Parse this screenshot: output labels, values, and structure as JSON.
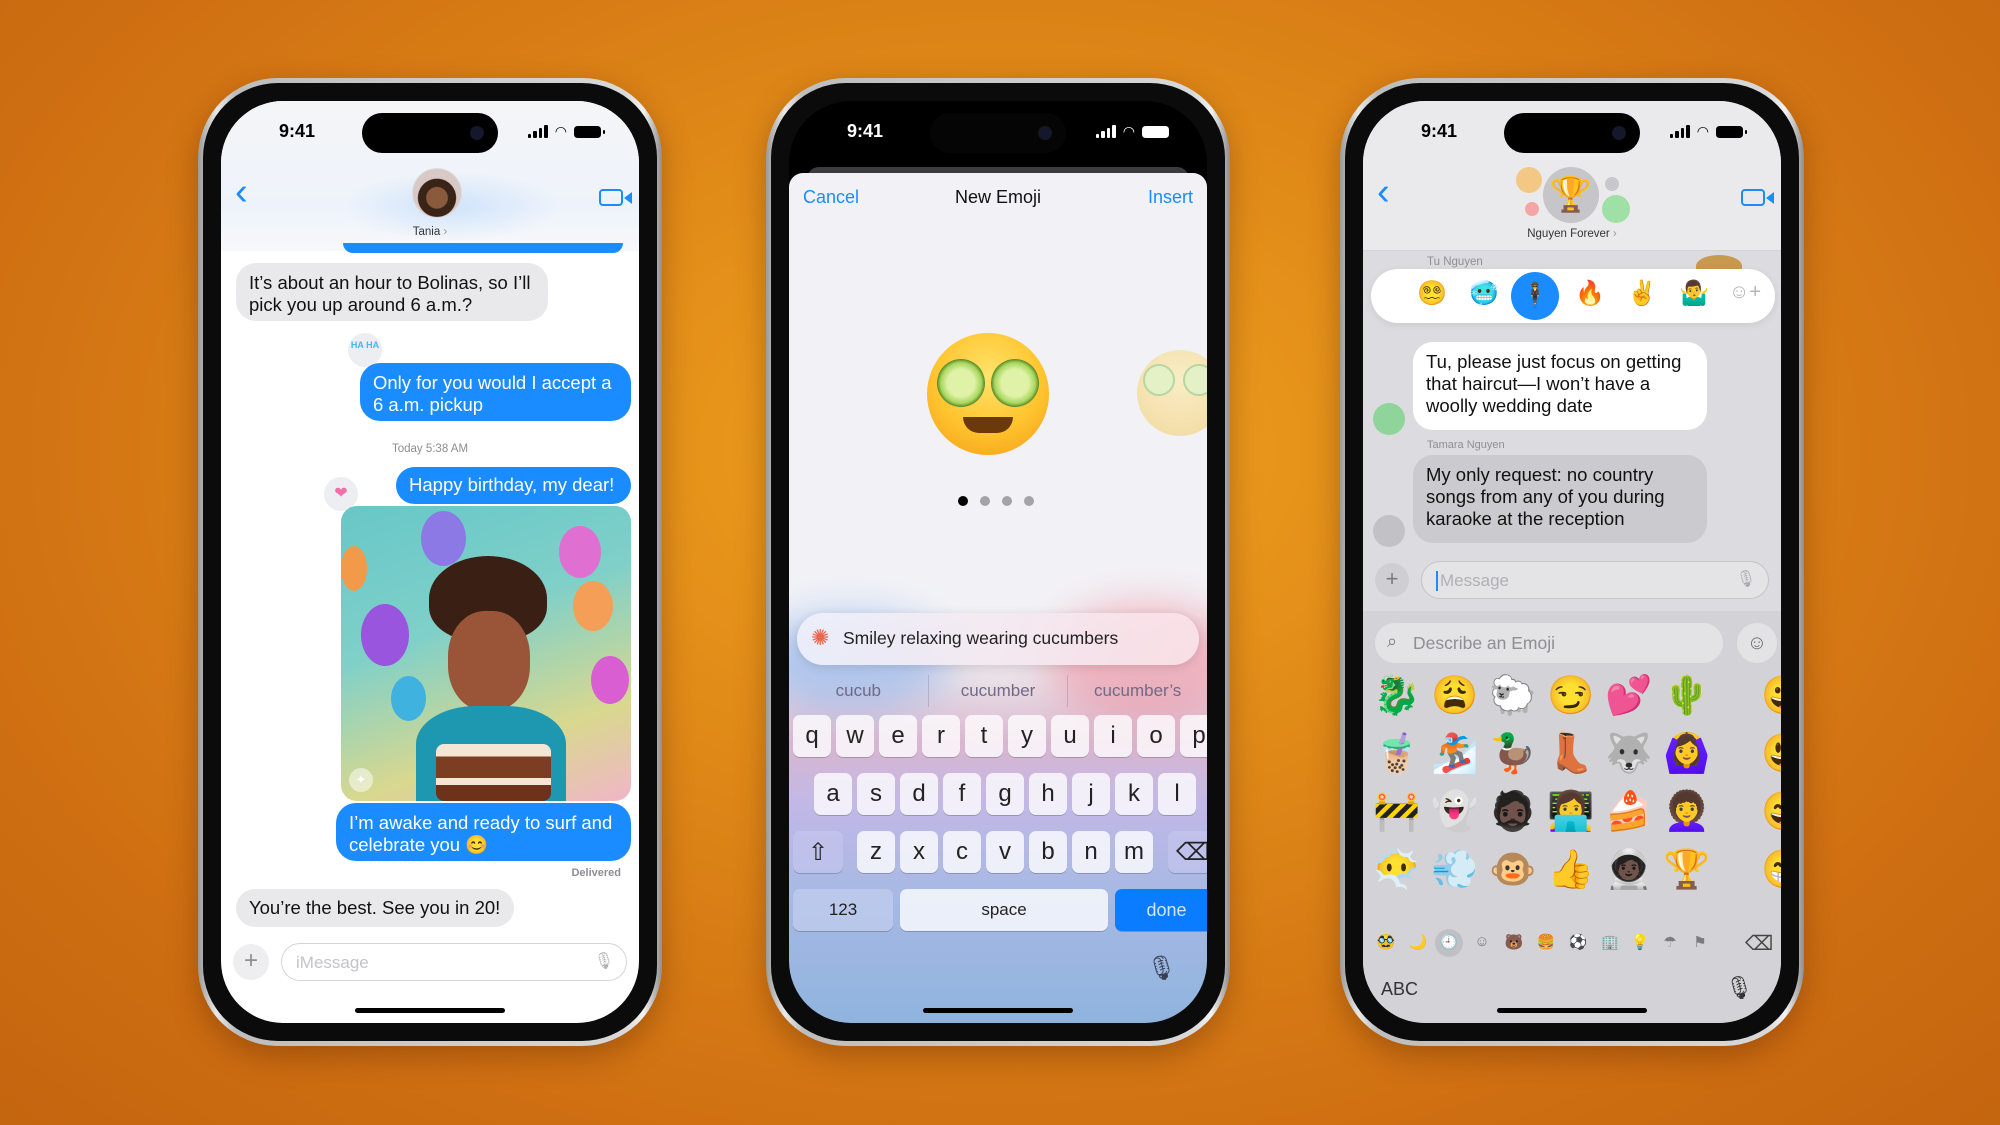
{
  "phones": {
    "left": {
      "status": {
        "time": "9:41"
      },
      "header": {
        "contact_name": "Tania",
        "name_chevron": "›",
        "back_icon": "‹"
      },
      "messages": [
        {
          "from": "them",
          "text": "It’s about an hour to Bolinas, so I’ll pick you up around 6 a.m.?"
        },
        {
          "from": "me",
          "text": "Only for you would I accept a 6 a.m. pickup",
          "tapback": "HA HA"
        },
        {
          "from": "me",
          "text": "Happy birthday, my dear!",
          "tapback": "❤"
        },
        {
          "from": "me",
          "type": "image",
          "description": "AI-generated birthday portrait with balloons and cake"
        },
        {
          "from": "me",
          "text": "I’m awake and ready to surf and celebrate you 😊"
        },
        {
          "from": "them",
          "text": "You’re the best. See you in 20!"
        }
      ],
      "timestamp": "Today 5:38 AM",
      "delivery_status": "Delivered",
      "input": {
        "placeholder": "iMessage",
        "plus": "+"
      }
    },
    "middle": {
      "status": {
        "time": "9:41"
      },
      "sheet": {
        "cancel_label": "Cancel",
        "title": "New Emoji",
        "insert_label": "Insert"
      },
      "generated_emoji": {
        "primary": "😌",
        "secondary": "😁",
        "page_count": 4,
        "current_page": 1
      },
      "prompt": {
        "text": "Smiley relaxing wearing cucumbers"
      },
      "suggestions": [
        "cucub",
        "cucumber",
        "cucumber’s"
      ],
      "keyboard": {
        "row1": [
          "q",
          "w",
          "e",
          "r",
          "t",
          "y",
          "u",
          "i",
          "o",
          "p"
        ],
        "row2": [
          "a",
          "s",
          "d",
          "f",
          "g",
          "h",
          "j",
          "k",
          "l"
        ],
        "row3": [
          "z",
          "x",
          "c",
          "v",
          "b",
          "n",
          "m"
        ],
        "shift": "⇧",
        "delete": "⌫",
        "numbers_label": "123",
        "space_label": "space",
        "done_label": "done"
      }
    },
    "right": {
      "status": {
        "time": "9:41"
      },
      "header": {
        "group_name": "Nguyen Forever",
        "name_chevron": "›",
        "group_icon": "🏆"
      },
      "sender_peek": "Tu Nguyen",
      "tapback_bar": [
        "😵‍💫",
        "🥶",
        "🕴",
        "🔥",
        "✌️",
        "🤷‍♂️",
        "☺+"
      ],
      "messages": [
        {
          "from": "self",
          "text": "Tu, please just focus on getting that haircut—I won’t have a woolly wedding date"
        },
        {
          "from": "Tamara Nguyen",
          "text": "My only request: no country songs from any of you during karaoke at the reception"
        }
      ],
      "sender_label": "Tamara Nguyen",
      "input": {
        "placeholder": "Message",
        "plus": "+"
      },
      "emoji_search": {
        "placeholder": "Describe an Emoji"
      },
      "emoji_grid": [
        [
          "🐉",
          "😩",
          "🐑",
          "😏",
          "💕",
          "🌵"
        ],
        [
          "🧋",
          "🏂",
          "🦆",
          "👢",
          "🐺",
          "🙆‍♀️"
        ],
        [
          "🚧",
          "👻",
          "🧔🏿",
          "👩‍💻",
          "🍰",
          "👩‍🦱"
        ],
        [
          "😶‍🌫️",
          "💨",
          "🐵",
          "👍",
          "🧑🏿‍🚀",
          "🏆"
        ]
      ],
      "emoji_grid_edge": [
        "😀",
        "😃",
        "😄",
        "😁"
      ],
      "categories": [
        "🥸",
        "🌙",
        "🕘",
        "☺",
        "🐻",
        "🍔",
        "⚽",
        "🏢",
        "💡",
        "☂",
        "⚑"
      ],
      "abc_label": "ABC"
    }
  },
  "colors": {
    "ios_blue": "#1a8cff",
    "background_orange": "#e08a18"
  }
}
